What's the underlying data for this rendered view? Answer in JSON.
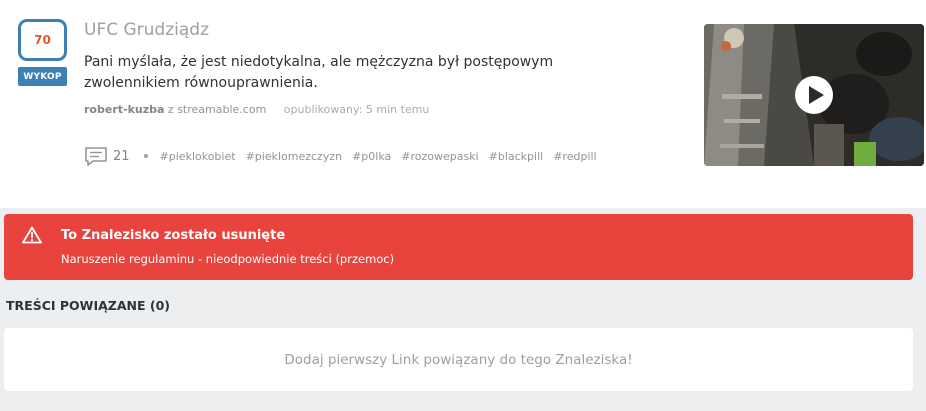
{
  "article": {
    "score": "70",
    "vote_label": "WYKOP",
    "title": "UFC Grudziądz",
    "description": "Pani myślała, że jest niedotykalna, ale mężczyzna był postępowym zwolennikiem równouprawnienia.",
    "author": "robert-kuzba",
    "source_prefix": "z",
    "source": "streamable.com",
    "published": "opublikowany: 5 min temu",
    "comments": "21",
    "tags": [
      "#pieklokobiet",
      "#pieklomezczyzn",
      "#p0lka",
      "#rozowepaski",
      "#blackpill",
      "#redpill"
    ],
    "thumbnail_icon": "play-icon"
  },
  "alert": {
    "title": "To Znalezisko zostało usunięte",
    "text": "Naruszenie regulaminu - nieodpowiednie treści (przemoc)",
    "icon": "warning-icon"
  },
  "related": {
    "heading": "TREŚCI POWIĄZANE (0)",
    "empty_text": "Dodaj pierwszy Link powiązany do tego Znaleziska!"
  },
  "colors": {
    "accent_blue": "#3d80b3",
    "score_orange": "#e05a2b",
    "alert_red": "#e8433d",
    "page_bg": "#eceeef"
  }
}
